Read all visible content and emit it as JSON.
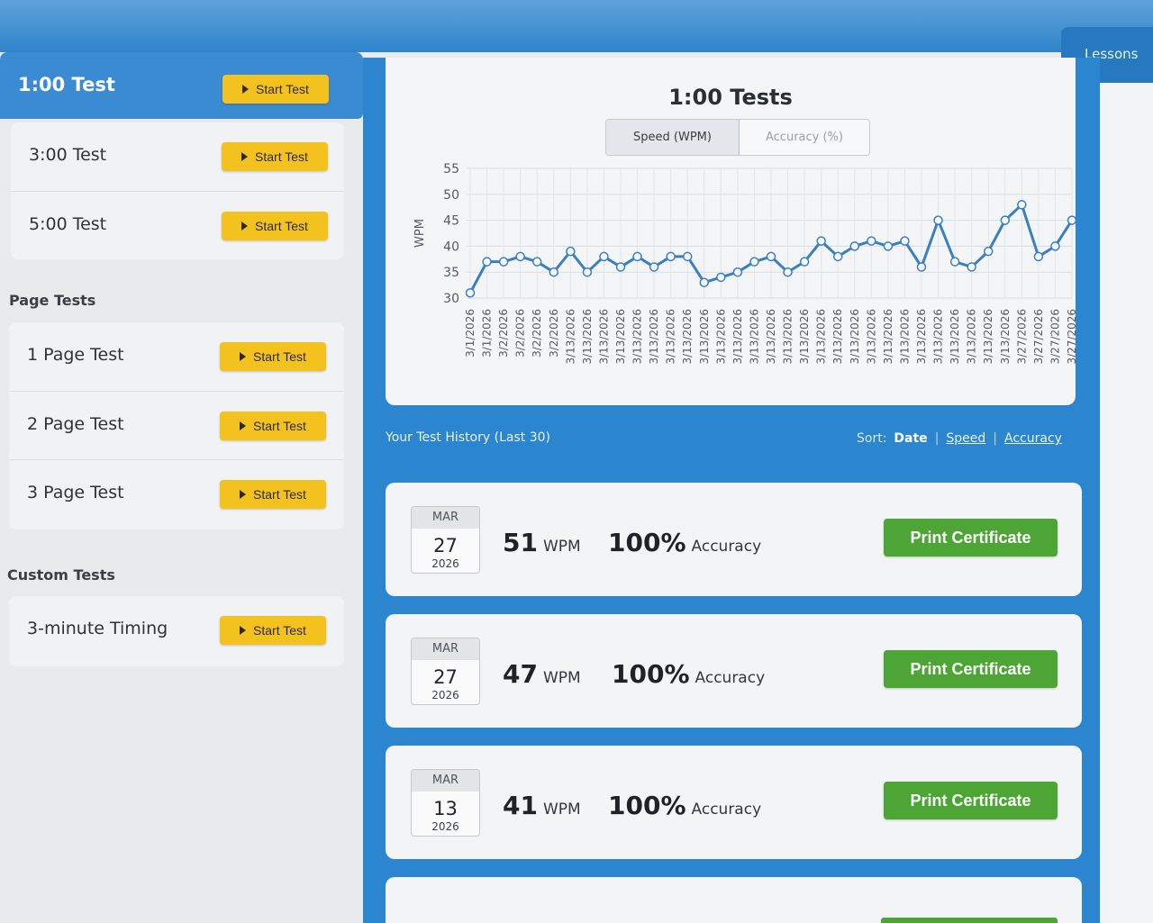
{
  "header": {
    "lessons_label": "Lessons"
  },
  "sidebar": {
    "active_test": {
      "label": "1:00 Test",
      "button": "Start Test"
    },
    "timed_tests": [
      {
        "label": "3:00 Test",
        "button": "Start Test"
      },
      {
        "label": "5:00 Test",
        "button": "Start Test"
      }
    ],
    "page_tests_title": "Page Tests",
    "page_tests": [
      {
        "label": "1 Page Test",
        "button": "Start Test"
      },
      {
        "label": "2 Page Test",
        "button": "Start Test"
      },
      {
        "label": "3 Page Test",
        "button": "Start Test"
      }
    ],
    "custom_tests_title": "Custom Tests",
    "custom_tests": [
      {
        "label": "3-minute Timing",
        "button": "Start Test"
      }
    ]
  },
  "chart_panel": {
    "title": "1:00 Tests",
    "tabs": [
      "Speed (WPM)",
      "Accuracy (%)"
    ],
    "active_tab": "Speed (WPM)"
  },
  "chart_data": {
    "type": "line",
    "ylabel": "WPM",
    "ylim": [
      30,
      55
    ],
    "yticks": [
      30,
      35,
      40,
      45,
      50,
      55
    ],
    "grid": true,
    "categories": [
      "3/1/2026",
      "3/1/2026",
      "3/2/2026",
      "3/2/2026",
      "3/2/2026",
      "3/2/2026",
      "3/13/2026",
      "3/13/2026",
      "3/13/2026",
      "3/13/2026",
      "3/13/2026",
      "3/13/2026",
      "3/13/2026",
      "3/13/2026",
      "3/13/2026",
      "3/13/2026",
      "3/13/2026",
      "3/13/2026",
      "3/13/2026",
      "3/13/2026",
      "3/13/2026",
      "3/13/2026",
      "3/13/2026",
      "3/13/2026",
      "3/13/2026",
      "3/13/2026",
      "3/13/2026",
      "3/13/2026",
      "3/13/2026",
      "3/13/2026",
      "3/13/2026",
      "3/13/2026",
      "3/13/2026",
      "3/27/2026",
      "3/27/2026",
      "3/27/2026",
      "3/27/2026"
    ],
    "values": [
      31,
      37,
      37,
      38,
      37,
      35,
      39,
      35,
      38,
      36,
      38,
      36,
      38,
      38,
      33,
      34,
      35,
      37,
      38,
      35,
      37,
      41,
      38,
      40,
      41,
      40,
      41,
      36,
      45,
      37,
      36,
      39,
      45,
      48,
      38,
      40,
      45
    ],
    "series_color": "#3a7fc1"
  },
  "history": {
    "title": "Your Test History (Last 30)",
    "sort_label": "Sort:",
    "sort_options": [
      "Date",
      "Speed",
      "Accuracy"
    ],
    "active_sort": "Date",
    "items": [
      {
        "month": "MAR",
        "day": "27",
        "year": "2026",
        "wpm": "51",
        "wpm_unit": "WPM",
        "accuracy": "100%",
        "accuracy_label": "Accuracy",
        "button": "Print Certificate"
      },
      {
        "month": "MAR",
        "day": "27",
        "year": "2026",
        "wpm": "47",
        "wpm_unit": "WPM",
        "accuracy": "100%",
        "accuracy_label": "Accuracy",
        "button": "Print Certificate"
      },
      {
        "month": "MAR",
        "day": "13",
        "year": "2026",
        "wpm": "41",
        "wpm_unit": "WPM",
        "accuracy": "100%",
        "accuracy_label": "Accuracy",
        "button": "Print Certificate"
      }
    ]
  },
  "colors": {
    "accent_blue": "#2b86cf",
    "start_button": "#f3c21e",
    "certificate_button": "#4ca535"
  }
}
